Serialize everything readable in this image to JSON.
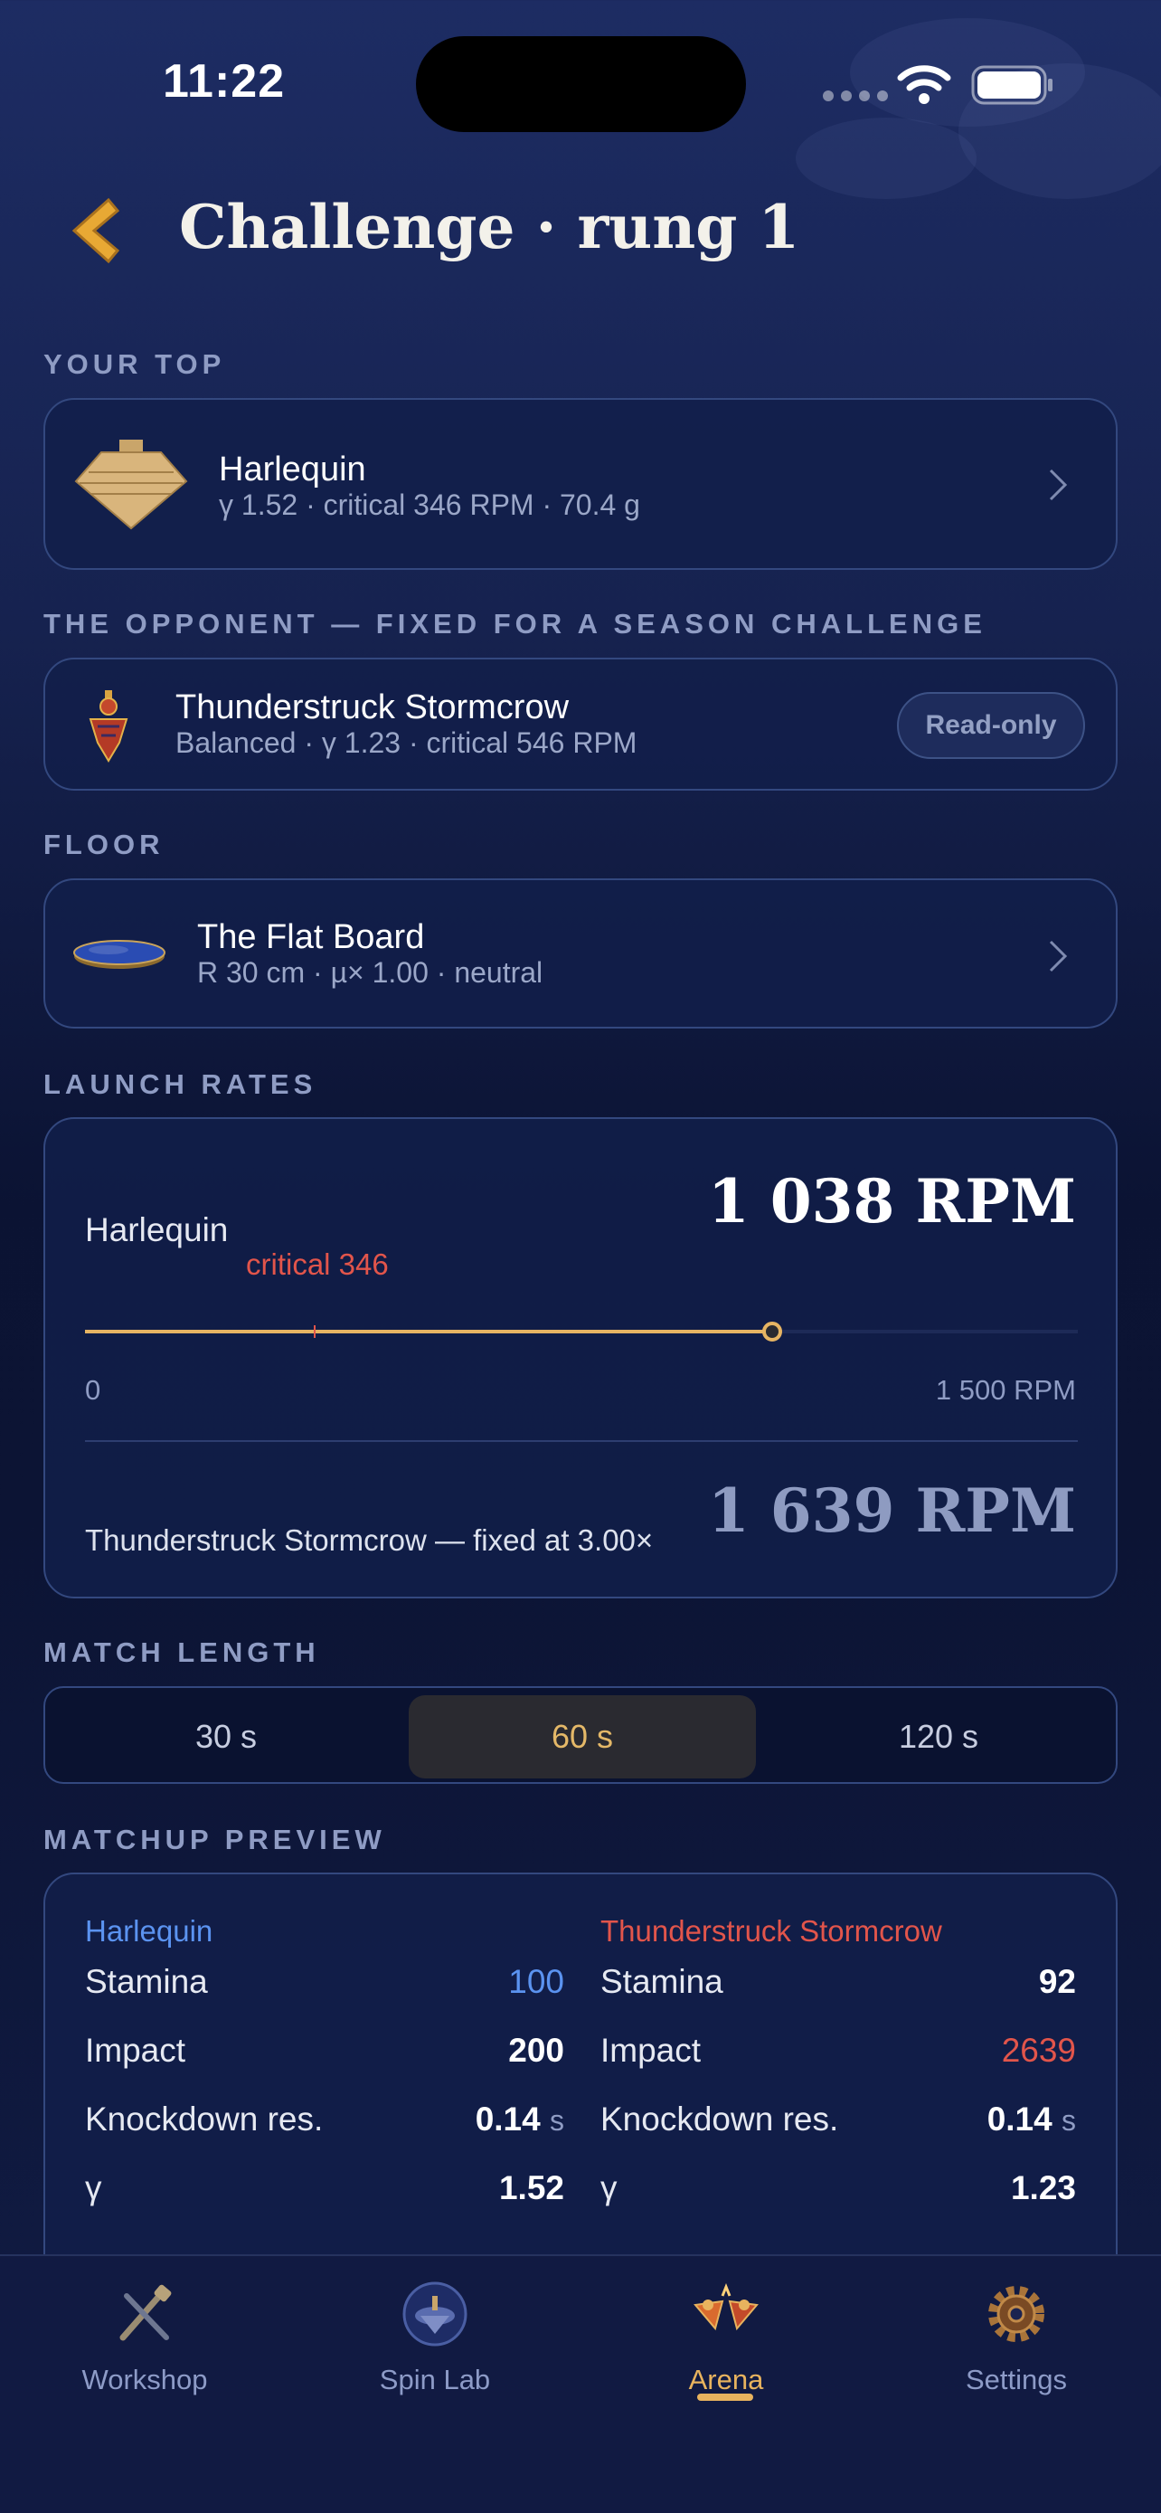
{
  "status_bar": {
    "time": "11:22"
  },
  "header": {
    "title": "Challenge · rung 1"
  },
  "your_top": {
    "section_label": "YOUR TOP",
    "name": "Harlequin",
    "details": "γ 1.52 · critical 346 RPM · 70.4 g"
  },
  "opponent": {
    "section_label": "THE OPPONENT — FIXED FOR A SEASON CHALLENGE",
    "name": "Thunderstruck Stormcrow",
    "details": "Balanced · γ 1.23 · critical 546 RPM",
    "badge": "Read-only"
  },
  "floor": {
    "section_label": "FLOOR",
    "name": "The Flat Board",
    "details": "R 30 cm · µ× 1.00 · neutral"
  },
  "launch_rates": {
    "section_label": "LAUNCH RATES",
    "player_name": "Harlequin",
    "player_rpm": "1 038 RPM",
    "critical_label": "critical 346",
    "slider_min": "0",
    "slider_max": "1 500 RPM",
    "slider_value": 1038,
    "slider_critical": 346,
    "slider_range_max": 1500,
    "opponent_text": "Thunderstruck Stormcrow — fixed at 3.00×",
    "opponent_rpm": "1 639 RPM"
  },
  "match_length": {
    "section_label": "MATCH LENGTH",
    "options": [
      "30 s",
      "60 s",
      "120 s"
    ],
    "selected": "60 s"
  },
  "preview": {
    "section_label": "MATCHUP PREVIEW",
    "left": {
      "name": "Harlequin",
      "stamina_label": "Stamina",
      "stamina": "100",
      "impact_label": "Impact",
      "impact": "200",
      "knockdown_label": "Knockdown res.",
      "knockdown": "0.14",
      "knockdown_unit": "s",
      "gamma_label": "γ",
      "gamma": "1.52"
    },
    "right": {
      "name": "Thunderstruck Stormcrow",
      "stamina_label": "Stamina",
      "stamina": "92",
      "impact_label": "Impact",
      "impact": "2639",
      "knockdown_label": "Knockdown res.",
      "knockdown": "0.14",
      "knockdown_unit": "s",
      "gamma_label": "γ",
      "gamma": "1.23"
    }
  },
  "tabs": [
    {
      "label": "Workshop",
      "icon": "tools-icon"
    },
    {
      "label": "Spin Lab",
      "icon": "spinning-top-icon"
    },
    {
      "label": "Arena",
      "icon": "clashing-tops-icon",
      "active": true
    },
    {
      "label": "Settings",
      "icon": "gear-icon"
    }
  ],
  "colors": {
    "accent": "#e8b35e",
    "player_blue": "#5b93f0",
    "opponent_red": "#e2554b"
  }
}
